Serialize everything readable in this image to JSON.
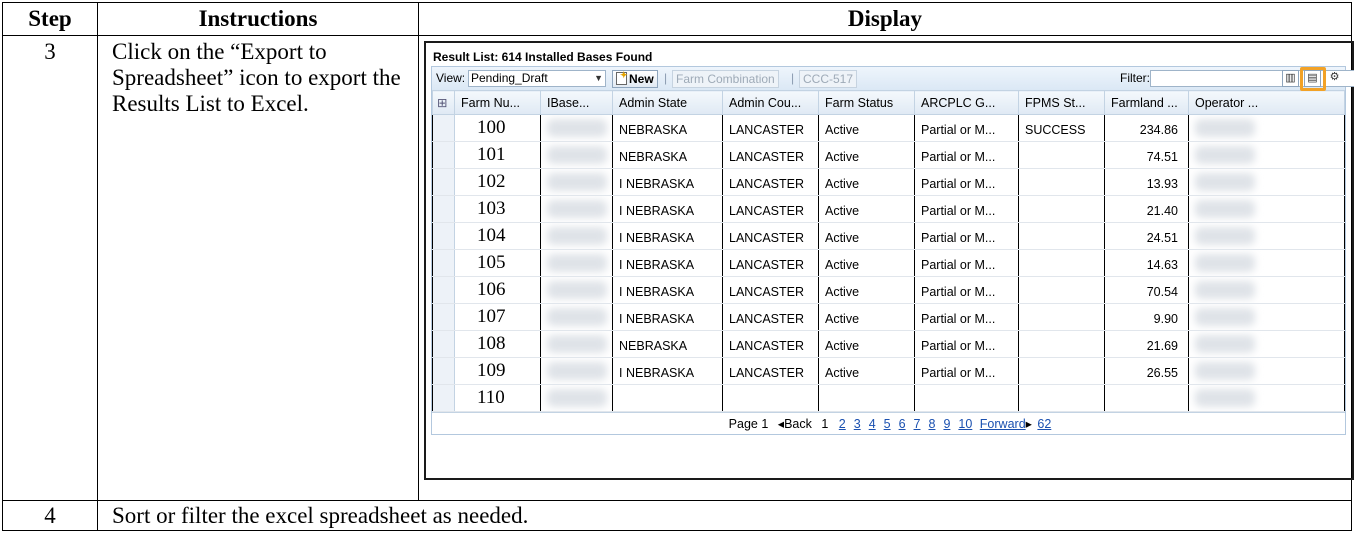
{
  "headers": {
    "step": "Step",
    "instructions": "Instructions",
    "display": "Display"
  },
  "steps": [
    {
      "number": "3",
      "instruction": "Click on the “Export to Spreadsheet” icon to export the Results List to Excel."
    },
    {
      "number": "4",
      "instruction": "Sort or filter the excel spreadsheet as needed."
    }
  ],
  "screen": {
    "result_title": "Result List: 614 Installed Bases Found",
    "toolbar": {
      "view_label": "View:",
      "view_value": "Pending_Draft",
      "new_label": "New",
      "separator": "|",
      "farm_combination": "Farm Combination",
      "ccc517": "CCC-517",
      "filter_label": "Filter:",
      "icons": [
        "chart-icon",
        "export-to-spreadsheet-icon",
        "settings-icon"
      ]
    },
    "columns": [
      "Farm Nu...",
      "IBase...",
      "Admin State",
      "Admin Cou...",
      "Farm Status",
      "ARCPLC G...",
      "FPMS St...",
      "Farmland ...",
      "Operator ..."
    ],
    "rows": [
      {
        "farm": "100",
        "prefix": "",
        "state": "NEBRASKA",
        "county": "LANCASTER",
        "status": "Active",
        "arcplc": "Partial or M...",
        "fpms": "SUCCESS",
        "farmland": "234.86"
      },
      {
        "farm": "101",
        "prefix": "",
        "state": "NEBRASKA",
        "county": "LANCASTER",
        "status": "Active",
        "arcplc": "Partial or M...",
        "fpms": "",
        "farmland": "74.51"
      },
      {
        "farm": "102",
        "prefix": "I",
        "state": "NEBRASKA",
        "county": "LANCASTER",
        "status": "Active",
        "arcplc": "Partial or M...",
        "fpms": "",
        "farmland": "13.93"
      },
      {
        "farm": "103",
        "prefix": "I",
        "state": "NEBRASKA",
        "county": "LANCASTER",
        "status": "Active",
        "arcplc": "Partial or M...",
        "fpms": "",
        "farmland": "21.40"
      },
      {
        "farm": "104",
        "prefix": "I",
        "state": "NEBRASKA",
        "county": "LANCASTER",
        "status": "Active",
        "arcplc": "Partial or M...",
        "fpms": "",
        "farmland": "24.51"
      },
      {
        "farm": "105",
        "prefix": "I",
        "state": "NEBRASKA",
        "county": "LANCASTER",
        "status": "Active",
        "arcplc": "Partial or M...",
        "fpms": "",
        "farmland": "14.63"
      },
      {
        "farm": "106",
        "prefix": "I",
        "state": "NEBRASKA",
        "county": "LANCASTER",
        "status": "Active",
        "arcplc": "Partial or M...",
        "fpms": "",
        "farmland": "70.54"
      },
      {
        "farm": "107",
        "prefix": "I",
        "state": "NEBRASKA",
        "county": "LANCASTER",
        "status": "Active",
        "arcplc": "Partial or M...",
        "fpms": "",
        "farmland": "9.90"
      },
      {
        "farm": "108",
        "prefix": "",
        "state": "NEBRASKA",
        "county": "LANCASTER",
        "status": "Active",
        "arcplc": "Partial or M...",
        "fpms": "",
        "farmland": "21.69"
      },
      {
        "farm": "109",
        "prefix": "I",
        "state": "NEBRASKA",
        "county": "LANCASTER",
        "status": "Active",
        "arcplc": "Partial or M...",
        "fpms": "",
        "farmland": "26.55"
      },
      {
        "farm": "110",
        "prefix": "",
        "state": "",
        "county": "",
        "status": "",
        "arcplc": "",
        "fpms": "",
        "farmland": ""
      }
    ],
    "pager": {
      "page_label": "Page 1",
      "back": "Back",
      "current": "1",
      "pages": [
        "2",
        "3",
        "4",
        "5",
        "6",
        "7",
        "8",
        "9",
        "10"
      ],
      "forward": "Forward",
      "last": "62"
    }
  }
}
